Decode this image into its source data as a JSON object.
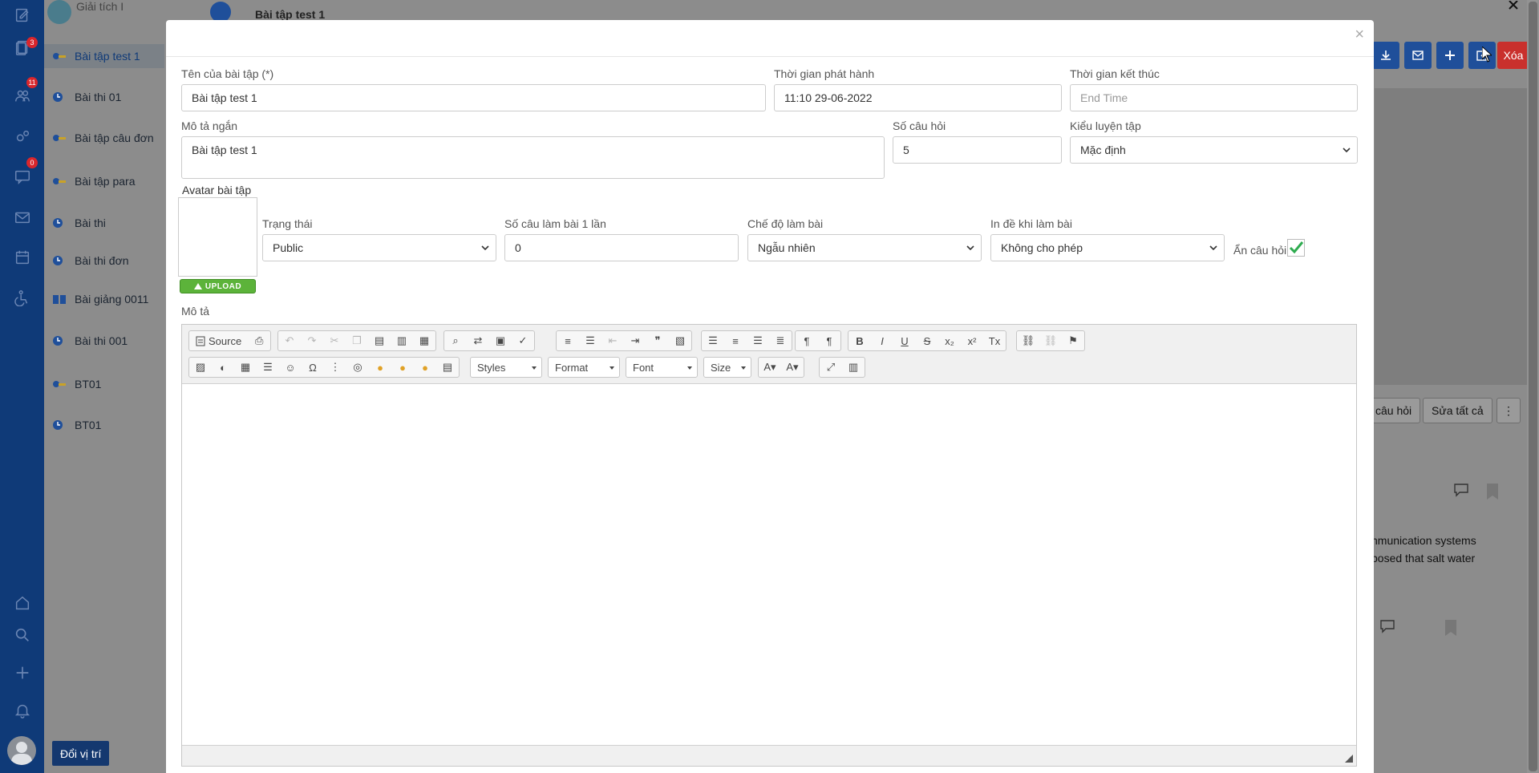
{
  "rail": {
    "badges": [
      "3",
      "11",
      "0"
    ]
  },
  "list": {
    "top_label": "Giải tích I",
    "items": [
      {
        "label": "Bài tập test 1",
        "kind": "key"
      },
      {
        "label": "Bài thi 01",
        "kind": "clock"
      },
      {
        "label": "Bài tập câu đơn",
        "kind": "key"
      },
      {
        "label": "Bài tập para",
        "kind": "key"
      },
      {
        "label": "Bài thi",
        "kind": "clock"
      },
      {
        "label": "Bài thi đơn",
        "kind": "clock"
      },
      {
        "label": "Bài giảng 0011",
        "kind": "book"
      },
      {
        "label": "Bài thi 001",
        "kind": "clock"
      },
      {
        "label": "BT01",
        "kind": "key"
      },
      {
        "label": "BT01",
        "kind": "clock"
      }
    ],
    "switch_button": "Đổi vị trí"
  },
  "background": {
    "header_title": "Bài tập test 1",
    "delete_button": "Xóa",
    "buttons": [
      "câu hỏi",
      "Sửa tất cả",
      "⋮"
    ],
    "text_lines": [
      "nmunication systems",
      "posed that salt water"
    ]
  },
  "modal": {
    "close_symbol": "×",
    "fields": {
      "title_label": "Tên của bài tập (*)",
      "title_value": "Bài tập test 1",
      "release_label": "Thời gian phát hành",
      "release_value": "11:10 29-06-2022",
      "end_label": "Thời gian kết thúc",
      "end_placeholder": "End Time",
      "short_desc_label": "Mô tả ngắn",
      "short_desc_value": "Bài tập test 1",
      "num_questions_label": "Số câu hỏi",
      "num_questions_value": "5",
      "practice_type_label": "Kiểu luyện tập",
      "practice_type_value": "Mặc định",
      "avatar_label": "Avatar bài tập",
      "upload_label": "UPLOAD",
      "status_label": "Trạng thái",
      "status_value": "Public",
      "per_attempt_label": "Số câu làm bài 1 lần",
      "per_attempt_value": "0",
      "mode_label": "Chế độ làm bài",
      "mode_value": "Ngẫu nhiên",
      "print_label": "In đề khi làm bài",
      "print_value": "Không cho phép",
      "hide_label": "Ẩn câu hỏi",
      "hide_checked": true,
      "description_label": "Mô tả"
    },
    "editor": {
      "source_label": "Source",
      "styles_label": "Styles",
      "format_label": "Format",
      "font_label": "Font",
      "size_label": "Size"
    }
  },
  "colors": {
    "rail": "#0f3a78",
    "accent_blue": "#1f4f9a",
    "danger": "#c9302c",
    "upload_green": "#5cb33a",
    "check_green": "#2eab4f"
  }
}
